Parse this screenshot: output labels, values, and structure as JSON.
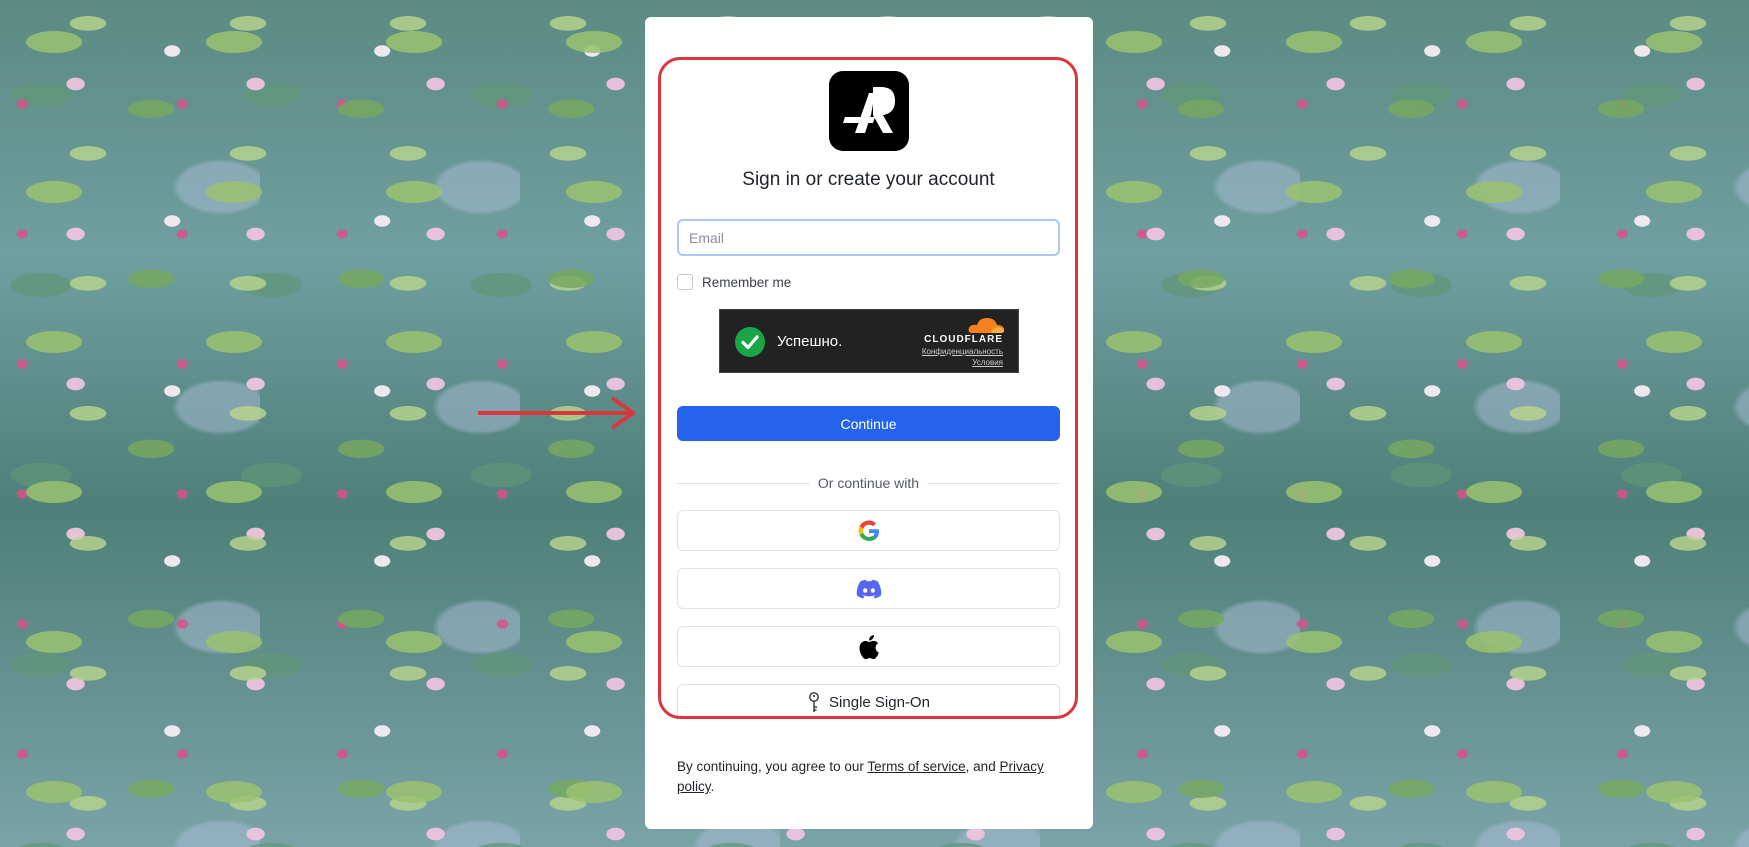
{
  "auth": {
    "title": "Sign in or create your account",
    "email_placeholder": "Email",
    "remember_label": "Remember me",
    "continue_label": "Continue",
    "divider_label": "Or continue with",
    "sso_label": "Single Sign-On"
  },
  "captcha": {
    "status_text": "Успешно.",
    "brand": "CLOUDFLARE",
    "privacy_link": "Конфиденциальность",
    "terms_link": "Условия"
  },
  "legal": {
    "prefix": "By continuing, you agree to our ",
    "terms_link": "Terms of service",
    "middle": ", and ",
    "privacy_link": "Privacy policy",
    "suffix": "."
  },
  "colors": {
    "primary": "#2563eb",
    "highlight": "#d9363e",
    "captcha_success": "#1aa548",
    "cloudflare_orange": "#f48120"
  },
  "icons": [
    "app-logo-icon",
    "check-icon",
    "cloudflare-icon",
    "google-icon",
    "discord-icon",
    "apple-icon",
    "key-icon",
    "arrow-annotation"
  ]
}
